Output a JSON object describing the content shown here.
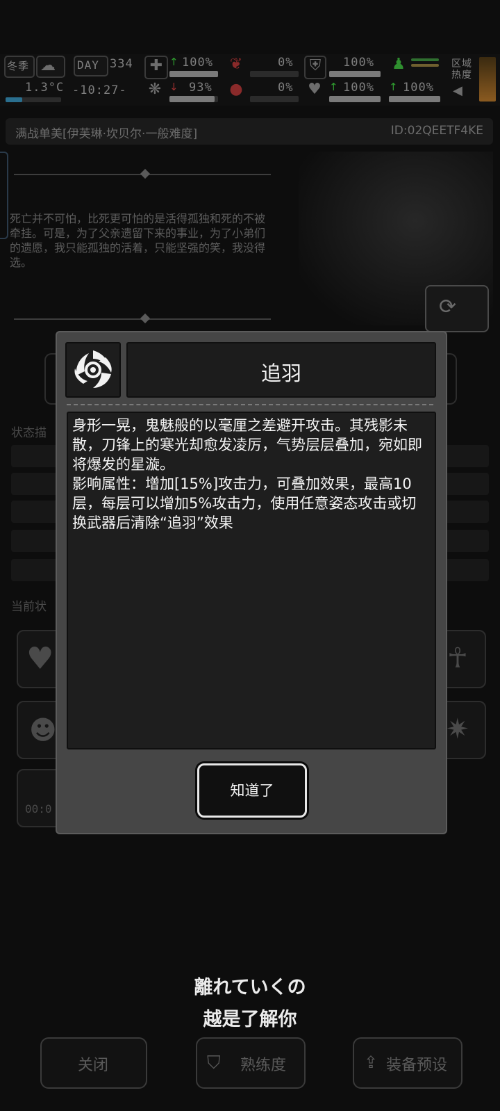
{
  "hud": {
    "season": "冬季",
    "day_label": "DAY",
    "day": "334",
    "temperature": "1.3°C",
    "time": "-10:27-",
    "stats": [
      {
        "name": "health-kit",
        "value": "100%",
        "fill": 1.0
      },
      {
        "name": "brain",
        "value": "93%",
        "fill": 0.93
      },
      {
        "name": "stomach",
        "value": "0%",
        "fill": 0.0
      },
      {
        "name": "blood",
        "value": "0%",
        "fill": 0.0
      },
      {
        "name": "armor",
        "value": "100%",
        "fill": 1.0
      },
      {
        "name": "heart",
        "value": "100%",
        "fill": 1.0
      },
      {
        "name": "boot",
        "value": "100%",
        "fill": 1.0
      }
    ],
    "zone_label": "区域\n热度"
  },
  "header": {
    "title": "满战单美[伊芙琳·坎贝尔·一般难度]",
    "id": "ID:02QEETF4KE"
  },
  "quote": "死亡并不可怕，比死更可怕的是活得孤独和死的不被牵挂。可是，为了父亲遗留下来的事业，为了小弟们的遗愿，我只能孤独的活着，只能坚强的笑，我没得选。",
  "background_labels": {
    "status_desc": "状态描",
    "current_status": "当前状"
  },
  "dialog": {
    "skill_name": "追羽",
    "description": "身形一晃，鬼魅般的以毫厘之差避开攻击。其残影未散，刀锋上的寒光却愈发凌厉，气势层层叠加，宛如即将爆发的星漩。\n影响属性：增加[15%]攻击力，可叠加效果，最高10层，每层可以增加5%攻击力，使用任意姿态攻击或切换武器后清除“追羽”效果",
    "ok_label": "知道了"
  },
  "subtitle": {
    "line1": "離れていくの",
    "line2": "越是了解你"
  },
  "bottom": {
    "close_label": "关闭",
    "proficiency_label": "熟练度",
    "preset_label": "装备预设"
  },
  "colors": {
    "dialog_bg": "#464646",
    "panel_bg": "#1e1e1e",
    "accent_up": "#2f9c2f"
  }
}
